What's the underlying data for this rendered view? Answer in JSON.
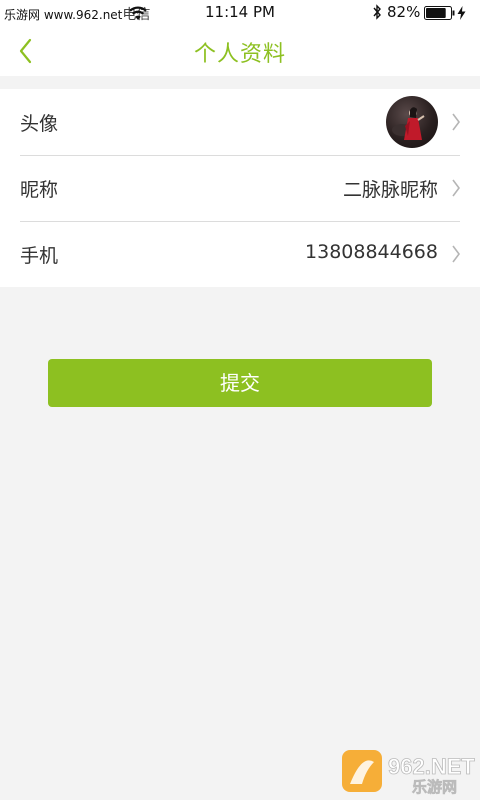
{
  "status_bar": {
    "carrier_site": "乐游网 www.962.net",
    "carrier_suffix": "电信",
    "time": "11:14 PM",
    "battery_percent": "82%",
    "battery_level": 0.82
  },
  "nav": {
    "title": "个人资料"
  },
  "profile": {
    "rows": [
      {
        "label": "头像"
      },
      {
        "label": "昵称",
        "value": "二脉脉昵称"
      },
      {
        "label": "手机",
        "value": "13808844668"
      }
    ]
  },
  "submit_label": "提交",
  "watermark": {
    "text_top": "962.NET",
    "text_bottom": "乐游网"
  },
  "colors": {
    "accent": "#8dc021",
    "background": "#f3f3f3"
  }
}
